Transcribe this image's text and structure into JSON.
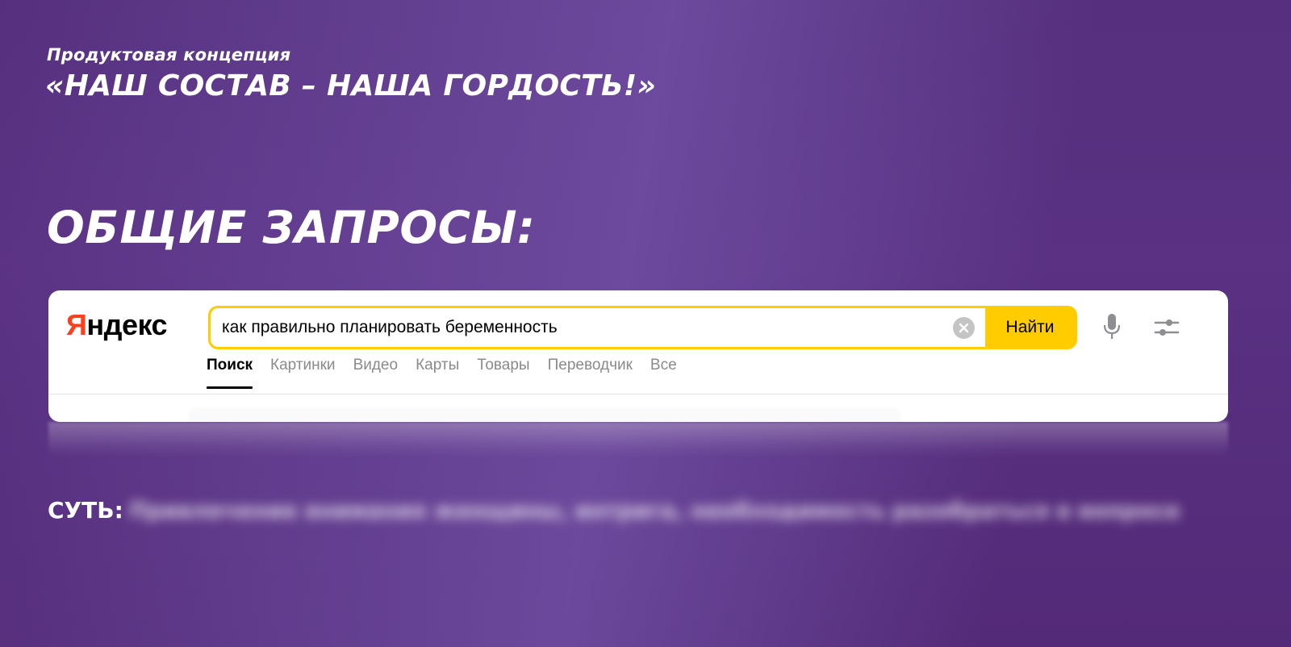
{
  "header": {
    "subtitle": "Продуктовая концепция",
    "headline": "«НАШ СОСТАВ – НАША ГОРДОСТЬ!»"
  },
  "section": {
    "title": "ОБЩИЕ ЗАПРОСЫ:"
  },
  "search_card": {
    "logo_first_letter": "Я",
    "logo_rest": "ндекс",
    "query": "как правильно планировать беременность",
    "find_button": "Найти",
    "tabs": [
      {
        "label": "Поиск",
        "active": true
      },
      {
        "label": "Картинки"
      },
      {
        "label": "Видео"
      },
      {
        "label": "Карты"
      },
      {
        "label": "Товары"
      },
      {
        "label": "Переводчик"
      },
      {
        "label": "Все"
      }
    ],
    "icons": {
      "clear": "clear-icon",
      "mic": "microphone-icon",
      "settings": "settings-sliders-icon"
    },
    "colors": {
      "accent": "#ffcc00",
      "logo_red": "#fc3f1d"
    }
  },
  "essence": {
    "label": "СУТЬ:",
    "text": "Привлечение внимания женщины, интрига, необходимость разобраться в вопросе"
  }
}
